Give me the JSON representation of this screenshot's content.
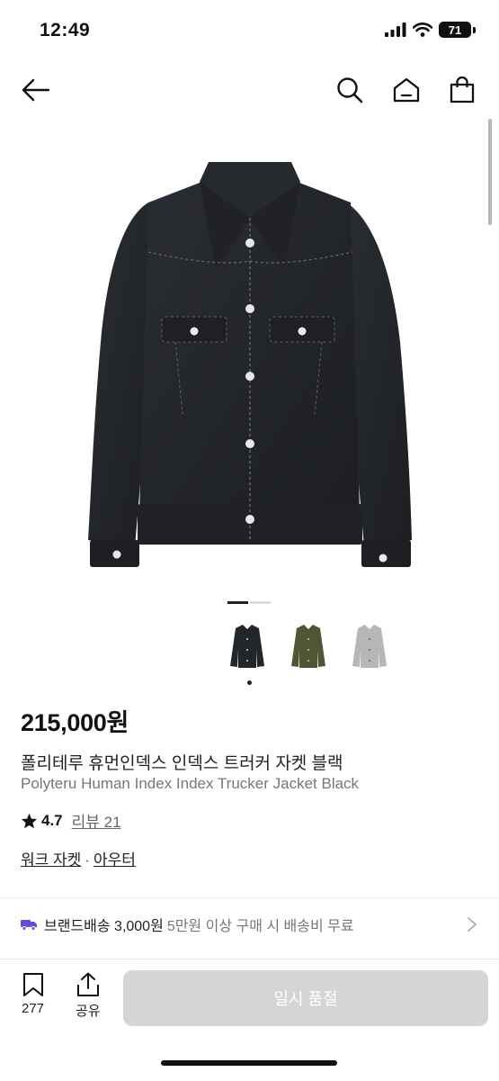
{
  "status_bar": {
    "time": "12:49",
    "battery": "71"
  },
  "nav": {
    "back_icon": "arrow-left-icon",
    "search_icon": "search-icon",
    "home_icon": "home-icon",
    "cart_icon": "shopping-bag-icon"
  },
  "gallery": {
    "current_page": 1,
    "total_pages": 2,
    "color_options": [
      "black",
      "olive",
      "grey"
    ],
    "selected_color_index": 0
  },
  "product": {
    "price": "215,000원",
    "title_ko": "폴리테루 휴먼인덱스 인덱스 트러커 자켓 블랙",
    "title_en": "Polyteru Human Index Index Trucker Jacket Black",
    "rating": "4.7",
    "review_label": "리뷰 21",
    "categories": [
      "워크 자켓",
      "아우터"
    ],
    "category_sep": "·"
  },
  "shipping": {
    "main": "브랜드배송 3,000원",
    "sub": "5만원 이상 구매 시 배송비 무료",
    "accent_color": "#6c4ad9"
  },
  "bottom_bar": {
    "bookmark_count": "277",
    "share_label": "공유",
    "cta_label": "일시 품절"
  },
  "colors": {
    "jacket_black": "#23262b",
    "jacket_olive": "#4f5535",
    "jacket_grey": "#b7b7b7",
    "cta_disabled": "#d5d5d5"
  }
}
